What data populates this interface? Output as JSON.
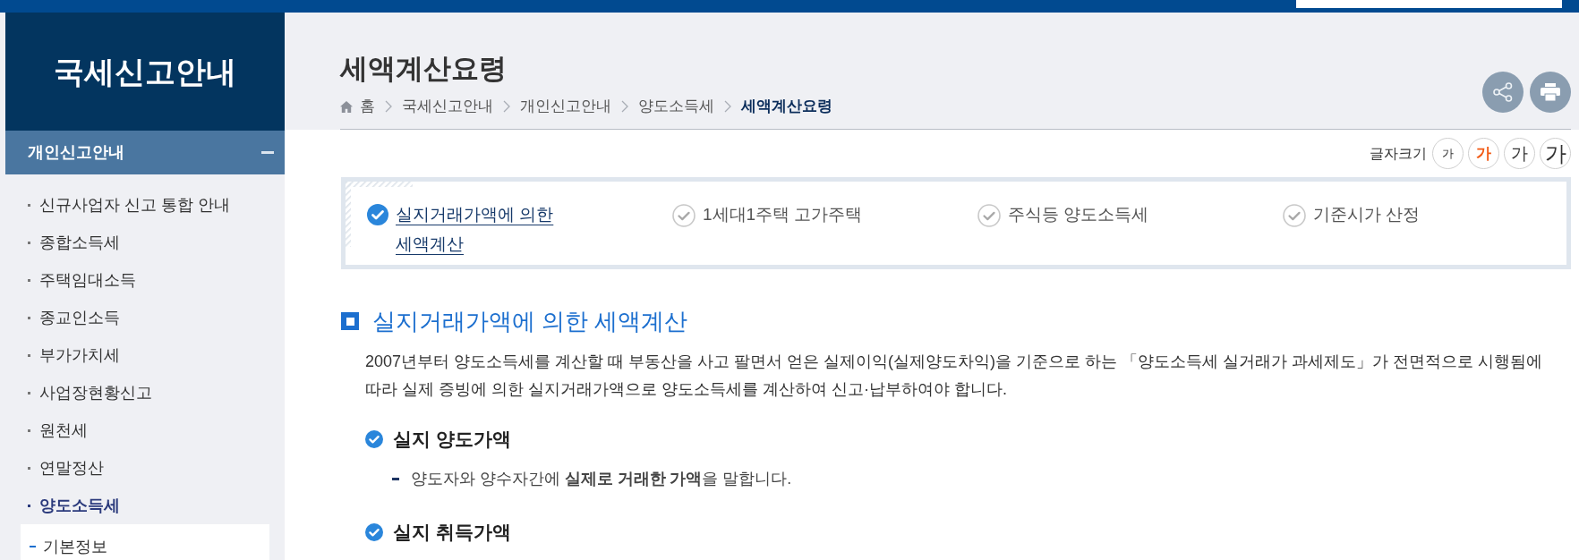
{
  "sidebar": {
    "title": "국세신고안내",
    "section": {
      "label": "개인신고안내",
      "expanded": true
    },
    "items": [
      {
        "label": "신규사업자 신고 통합 안내",
        "selected": false
      },
      {
        "label": "종합소득세",
        "selected": false
      },
      {
        "label": "주택임대소득",
        "selected": false
      },
      {
        "label": "종교인소득",
        "selected": false
      },
      {
        "label": "부가가치세",
        "selected": false
      },
      {
        "label": "사업장현황신고",
        "selected": false
      },
      {
        "label": "원천세",
        "selected": false
      },
      {
        "label": "연말정산",
        "selected": false
      },
      {
        "label": "양도소득세",
        "selected": true,
        "children": [
          {
            "label": "기본정보",
            "selected": false
          }
        ]
      }
    ]
  },
  "page": {
    "title": "세액계산요령",
    "breadcrumb": [
      {
        "label": "홈",
        "current": false
      },
      {
        "label": "국세신고안내",
        "current": false
      },
      {
        "label": "개인신고안내",
        "current": false
      },
      {
        "label": "양도소득세",
        "current": false
      },
      {
        "label": "세액계산요령",
        "current": true
      }
    ]
  },
  "font_size": {
    "label": "글자크기",
    "options": [
      {
        "label": "가",
        "selected": false
      },
      {
        "label": "가",
        "selected": true
      },
      {
        "label": "가",
        "selected": false
      },
      {
        "label": "가",
        "selected": false
      }
    ]
  },
  "tabs": [
    {
      "label": "실지거래가액에 의한 세액계산",
      "selected": true
    },
    {
      "label": "1세대1주택 고가주택",
      "selected": false
    },
    {
      "label": "주식등 양도소득세",
      "selected": false
    },
    {
      "label": "기준시가 산정",
      "selected": false
    }
  ],
  "section": {
    "title": "실지거래가액에 의한 세액계산",
    "intro": "2007년부터 양도소득세를 계산할 때 부동산을 사고 팔면서 얻은 실제이익(실제양도차익)을 기준으로 하는 「양도소득세 실거래가 과세제도」가 전면적으로 시행됨에 따라 실제 증빙에 의한 실지거래가액으로 양도소득세를 계산하여 신고·납부하여야 합니다.",
    "items": [
      {
        "title": "실지 양도가액",
        "points": [
          "양도자와 양수자간에 **실제로 거래한 가액**을 말합니다."
        ]
      },
      {
        "title": "실지 취득가액"
      }
    ]
  }
}
